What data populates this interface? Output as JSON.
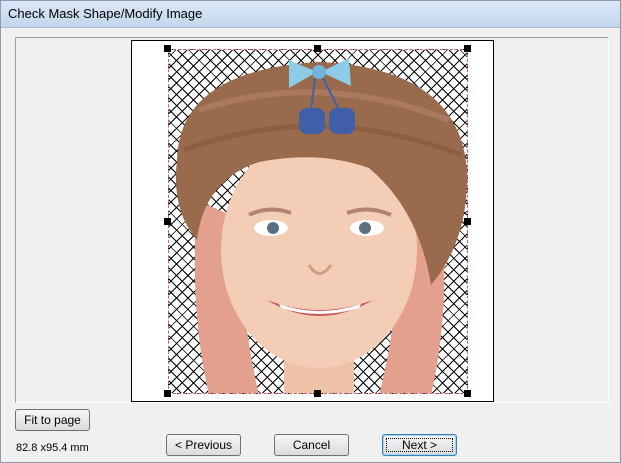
{
  "window": {
    "title": "Check Mask Shape/Modify Image"
  },
  "buttons": {
    "fit_to_page": "Fit to page",
    "previous": "< Previous",
    "cancel": "Cancel",
    "next": "Next >"
  },
  "status": {
    "size_text": "82.8 x95.4 mm"
  },
  "colors": {
    "mask_border": "#c06070",
    "hat": "#9a6a4c",
    "bow": "#8ecbe8",
    "charms": "#3f5fa8",
    "hair": "#e8a090",
    "skin": "#f4cdb6"
  }
}
